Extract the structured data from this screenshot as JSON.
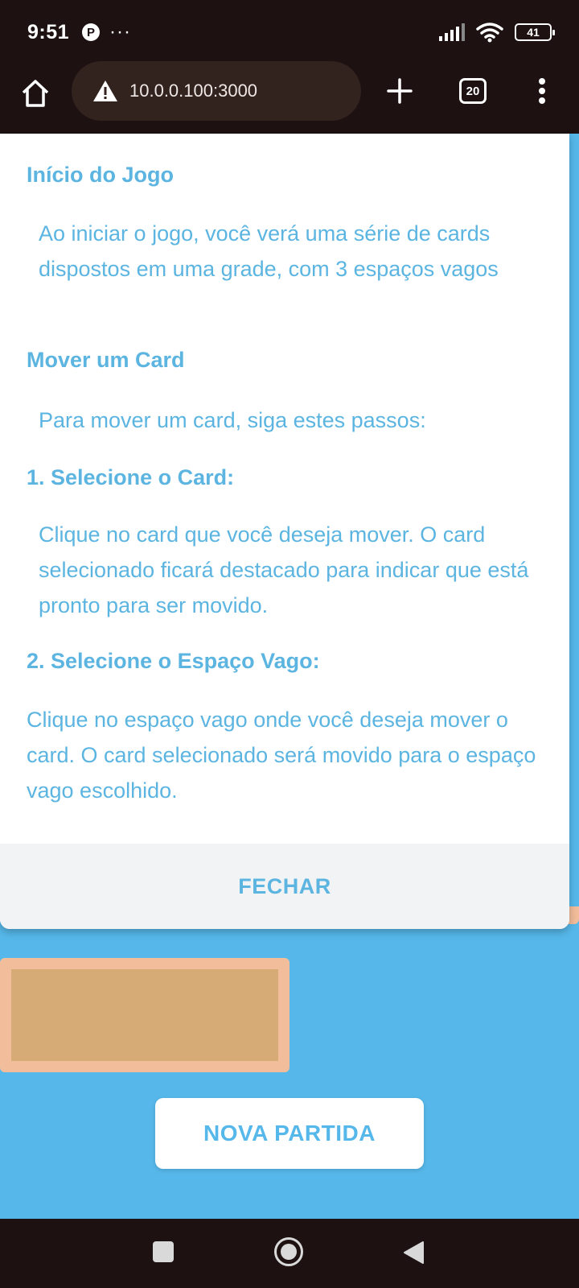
{
  "status_bar": {
    "time": "9:51",
    "pin_glyph": "P",
    "dots": "···",
    "battery": "41"
  },
  "browser": {
    "url": "10.0.0.100:3000",
    "tabs_count": "20"
  },
  "modal": {
    "heading_start": "Início do Jogo",
    "text_start": "Ao iniciar o jogo, você verá uma série de cards dispostos em uma grade, com 3 espaços vagos",
    "heading_move": "Mover um Card",
    "text_move": "Para mover um card, siga estes passos:",
    "heading_step1": "1. Selecione o Card:",
    "text_step1": "Clique no card que você deseja mover. O card selecionado ficará destacado para indicar que está pronto para ser movido.",
    "heading_step2": "2. Selecione o Espaço Vago:",
    "text_step2": "Clique no espaço vago onde você deseja mover o card. O card selecionado será movido para o espaço vago escolhido.",
    "close_label": "FECHAR"
  },
  "game": {
    "new_game_label": "NOVA PARTIDA"
  },
  "colors": {
    "accent": "#56b8ea",
    "card_border": "#f1bd9a",
    "card_fill": "#d6ab76",
    "chrome": "#1d1112"
  }
}
